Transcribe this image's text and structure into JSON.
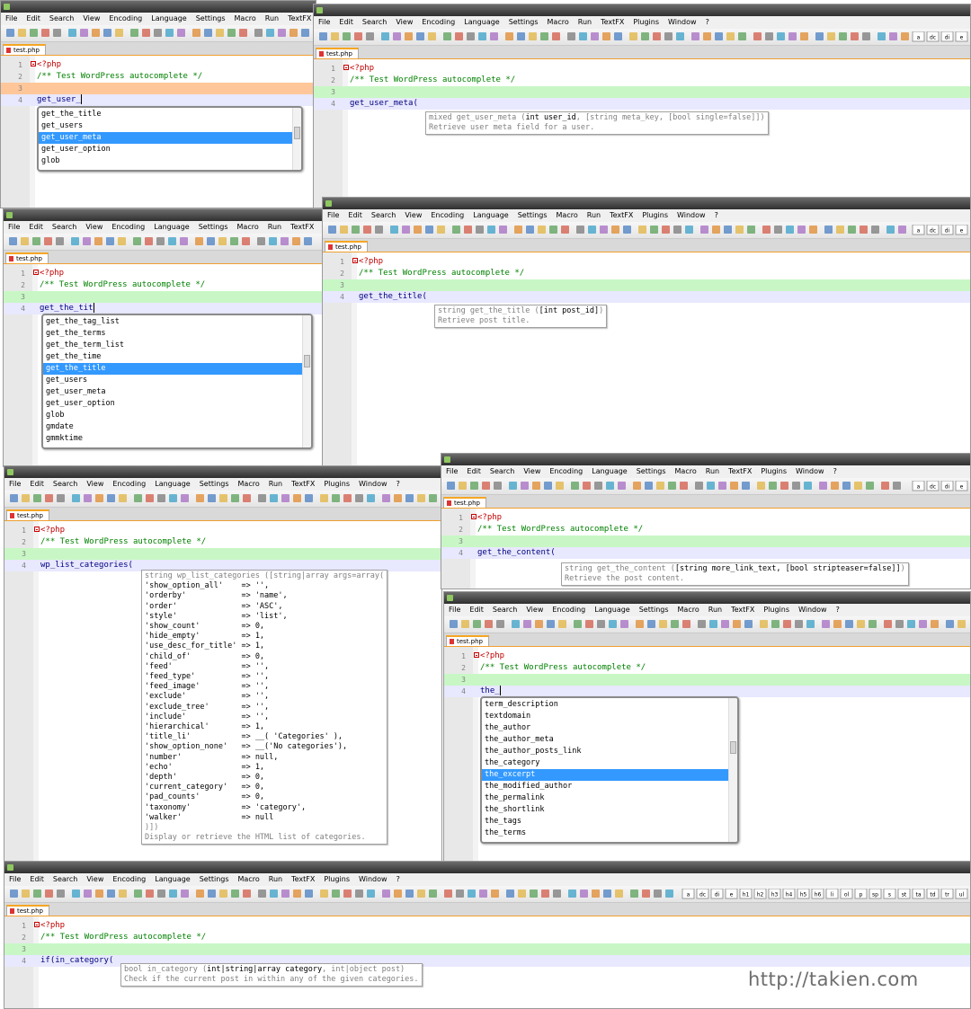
{
  "menus": {
    "full": [
      "File",
      "Edit",
      "Search",
      "View",
      "Encoding",
      "Language",
      "Settings",
      "Macro",
      "Run",
      "TextFX",
      "Plugins",
      "Window",
      "?"
    ],
    "p1": [
      "File",
      "Edit",
      "Search",
      "View",
      "Encoding",
      "Language",
      "Settings",
      "Macro",
      "Run",
      "TextFX",
      "Plugins"
    ],
    "p3": [
      "File",
      "Edit",
      "Search",
      "View",
      "Encoding",
      "Language",
      "Settings",
      "Macro",
      "Run",
      "TextFX",
      "Plugins",
      "W"
    ]
  },
  "tab_label": "test.php",
  "code": {
    "open_tag": "<?php",
    "comment": "/** Test WordPress autocomplete */"
  },
  "panels": {
    "p1": {
      "typed": "get_user_",
      "list": [
        "get_the_title",
        "get_users",
        "get_user_meta",
        "get_user_option",
        "glob"
      ],
      "selected": 2
    },
    "p2": {
      "typed": "get_user_meta(",
      "tip_sig": "mixed get_user_meta (",
      "tip_bold": "int user_id",
      "tip_rest": ", [string meta_key, [bool single=false]])",
      "tip_desc": "Retrieve user meta field for a user."
    },
    "p3": {
      "typed": "get_the_tit",
      "list": [
        "get_the_tag_list",
        "get_the_terms",
        "get_the_term_list",
        "get_the_time",
        "get_the_title",
        "get_users",
        "get_user_meta",
        "get_user_option",
        "glob",
        "gmdate",
        "gmmktime"
      ],
      "selected": 4
    },
    "p4": {
      "typed": "get_the_title(",
      "tip_sig": "string get_the_title (",
      "tip_bold": "[int post_id]",
      "tip_rest": ")",
      "tip_desc": "Retrieve post title."
    },
    "p5": {
      "typed": "wp_list_categories(",
      "tip_lines": [
        "string wp_list_categories ([string|array args=array(",
        "'show_option_all'    => '',",
        "'orderby'            => 'name',",
        "'order'              => 'ASC',",
        "'style'              => 'list',",
        "'show_count'         => 0,",
        "'hide_empty'         => 1,",
        "'use_desc_for_title' => 1,",
        "'child_of'           => 0,",
        "'feed'               => '',",
        "'feed_type'          => '',",
        "'feed_image'         => '',",
        "'exclude'            => '',",
        "'exclude_tree'       => '',",
        "'include'            => '',",
        "'hierarchical'       => 1,",
        "'title_li'           => __( 'Categories' ),",
        "'show_option_none'   => __('No categories'),",
        "'number'             => null,",
        "'echo'               => 1,",
        "'depth'              => 0,",
        "'current_category'   => 0,",
        "'pad_counts'         => 0,",
        "'taxonomy'           => 'category',",
        "'walker'             => null",
        ")])"
      ],
      "tip_desc": "Display or retrieve the HTML list of categories."
    },
    "p6": {
      "typed": "get_the_content(",
      "tip_sig": "string get_the_content (",
      "tip_bold": "[string more_link_text, [bool stripteaser=false]]",
      "tip_rest": ")",
      "tip_desc": "Retrieve the post content."
    },
    "p7": {
      "typed": "the_",
      "list": [
        "term_description",
        "textdomain",
        "the_author",
        "the_author_meta",
        "the_author_posts_link",
        "the_category",
        "the_excerpt",
        "the_modified_author",
        "the_permalink",
        "the_shortlink",
        "the_tags",
        "the_terms"
      ],
      "selected": 6
    },
    "p8": {
      "typed": "if(in_category(",
      "tip_sig": "bool in_category (",
      "tip_bold": "int|string|array category",
      "tip_rest": ", int|object post)",
      "tip_desc": "Check if the current post in within any of the given categories.",
      "tb_labels": [
        "a",
        "dc",
        "di",
        "e",
        "h1",
        "h2",
        "h3",
        "h4",
        "h5",
        "h6",
        "li",
        "ol",
        "p",
        "sp",
        "s",
        "st",
        "ta",
        "td",
        "tr",
        "ul"
      ]
    }
  },
  "tb_labels": [
    "a",
    "dc",
    "di",
    "e"
  ],
  "line_numbers": [
    "1",
    "2",
    "3",
    "4"
  ],
  "watermark": "http://takien.com",
  "colors": {
    "php_tag": "#c00000",
    "comment": "#008000",
    "selection": "#3399ff",
    "line_highlight": "#c8f7c5",
    "edit_highlight": "#ffc799"
  }
}
